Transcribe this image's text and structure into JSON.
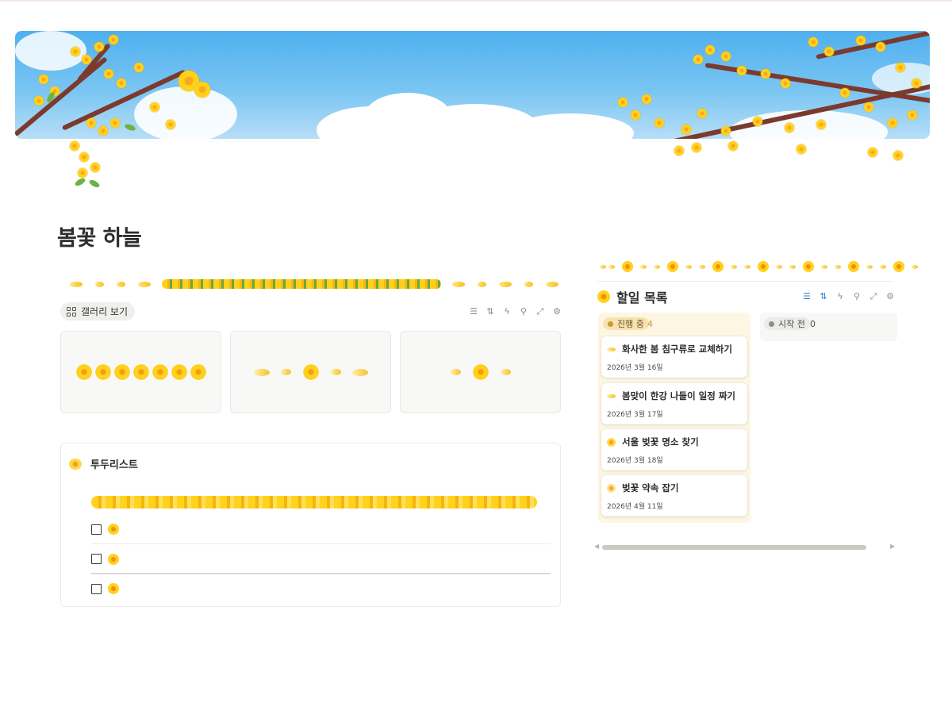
{
  "page": {
    "title": "봄꽃 하늘"
  },
  "gallery": {
    "view_label": "갤러리 보기",
    "toolbar_icons": [
      "filter-icon",
      "sort-icon",
      "lightning-icon",
      "search-icon",
      "expand-icon",
      "settings-icon"
    ]
  },
  "todo_block": {
    "title": "투두리스트",
    "items": [
      {
        "checked": false,
        "text": ""
      },
      {
        "checked": false,
        "text": ""
      },
      {
        "checked": false,
        "text": ""
      }
    ]
  },
  "task_db": {
    "title": "할일 목록",
    "toolbar_icons": [
      "filter-icon",
      "sort-icon",
      "lightning-icon",
      "search-icon",
      "expand-icon",
      "settings-icon"
    ],
    "columns": [
      {
        "status": "진행 중",
        "count": "4",
        "color": "#c89a2c",
        "cards": [
          {
            "title": "화사한 봄 침구류로 교체하기",
            "date": "2026년 3월 16일",
            "icon": "petal-icon"
          },
          {
            "title": "봄맞이 한강 나들이 일정 짜기",
            "date": "2026년 3월 17일",
            "icon": "petal-icon"
          },
          {
            "title": "서울 벚꽃 명소 찾기",
            "date": "2026년 3월 18일",
            "icon": "forsythia-icon"
          },
          {
            "title": "벚꽃 약속 잡기",
            "date": "2026년 4월 11일",
            "icon": "blossom-icon"
          }
        ]
      },
      {
        "status": "시작 전",
        "count": "0",
        "color": "#8e8c86",
        "cards": []
      }
    ]
  },
  "colors": {
    "sky": "#4fb0ef",
    "forsythia_yellow": "#ffd21c",
    "branch_brown": "#7b3a2d",
    "in_progress_bg": "#fdf6e2",
    "accent_blue": "#2a84d2"
  }
}
